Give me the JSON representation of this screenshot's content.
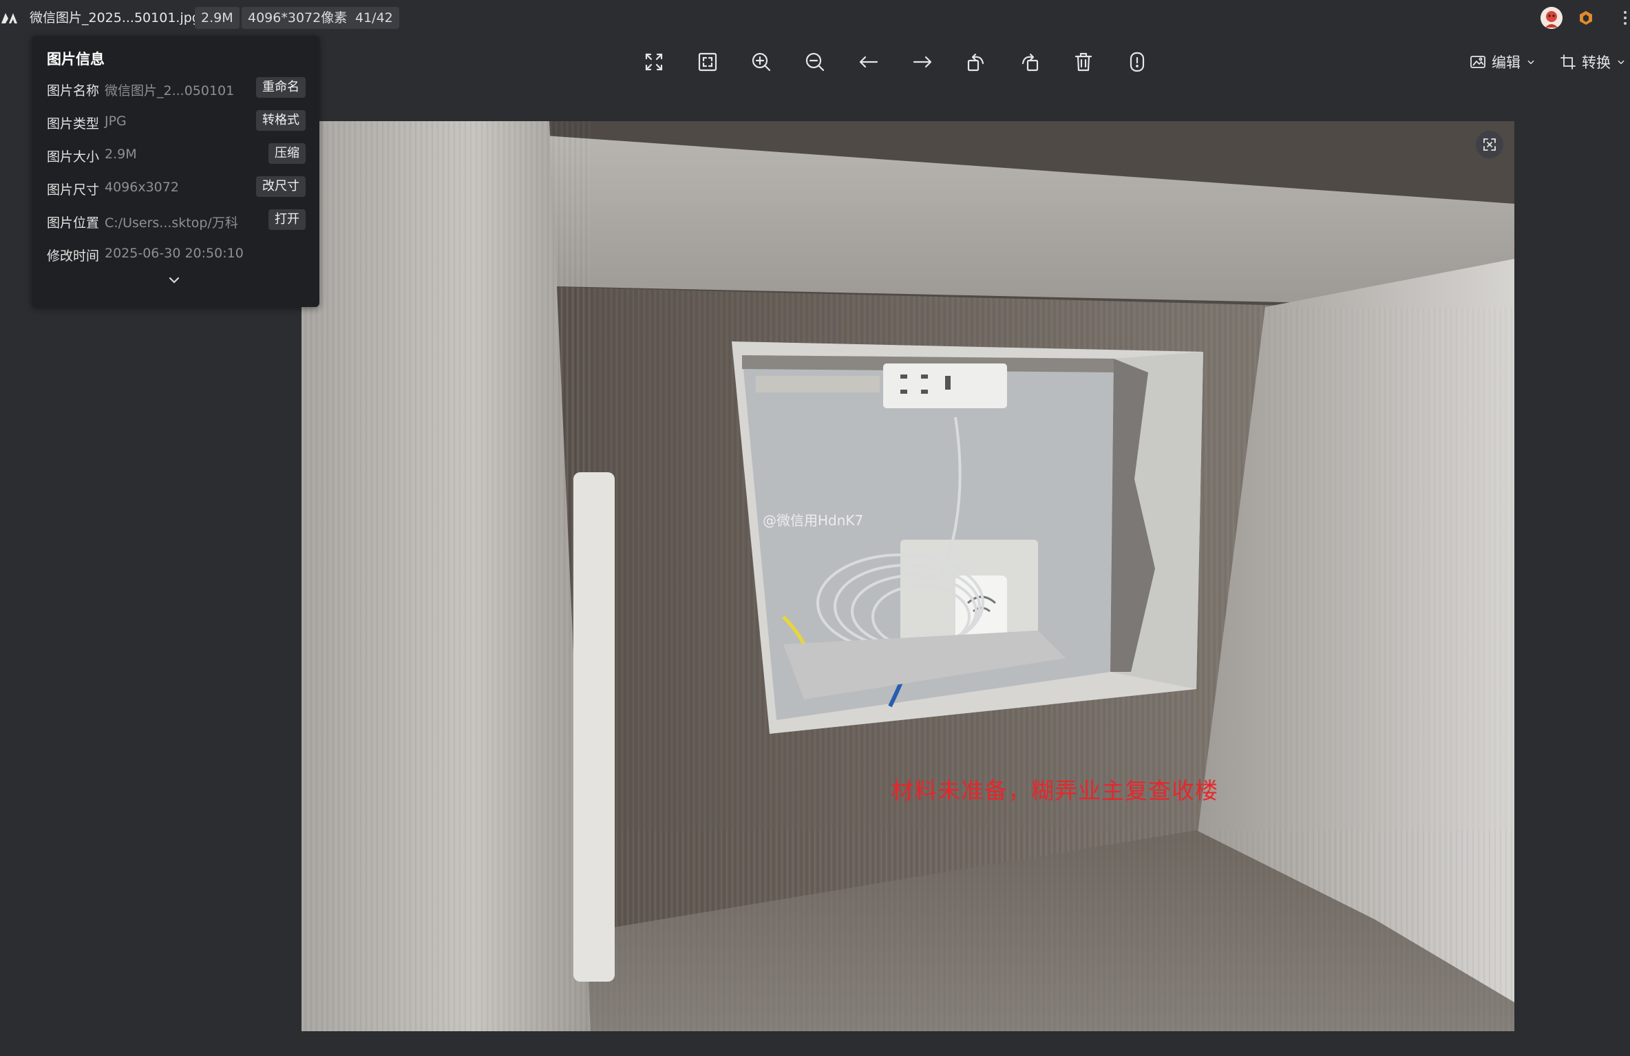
{
  "titlebar": {
    "file_name": "微信图片_2025...50101.jpg",
    "file_size": "2.9M",
    "dimensions": "4096*3072像素",
    "index": "41/42",
    "logo_icon": "app-logo-icon",
    "avatar_icon": "user-avatar-icon",
    "badge_icon": "vip-badge-icon",
    "more_icon": "more-icon"
  },
  "toolbar": {
    "buttons": [
      {
        "name": "fullscreen",
        "icon": "expand-arrows-icon"
      },
      {
        "name": "fit-window",
        "icon": "fit-frame-icon"
      },
      {
        "name": "zoom-in",
        "icon": "zoom-in-icon"
      },
      {
        "name": "zoom-out",
        "icon": "zoom-out-icon"
      },
      {
        "name": "previous",
        "icon": "arrow-left-icon"
      },
      {
        "name": "next",
        "icon": "arrow-right-icon"
      },
      {
        "name": "rotate-left",
        "icon": "rotate-left-icon"
      },
      {
        "name": "rotate-right",
        "icon": "rotate-right-icon"
      },
      {
        "name": "delete",
        "icon": "trash-icon"
      },
      {
        "name": "info",
        "icon": "info-icon"
      }
    ],
    "edit_label": "编辑",
    "convert_label": "转换"
  },
  "info_panel": {
    "title": "图片信息",
    "rows": [
      {
        "label": "图片名称",
        "value": "微信图片_2...050101",
        "button": "重命名"
      },
      {
        "label": "图片类型",
        "value": "JPG",
        "button": "转格式"
      },
      {
        "label": "图片大小",
        "value": "2.9M",
        "button": "压缩"
      },
      {
        "label": "图片尺寸",
        "value": "4096x3072",
        "button": "改尺寸"
      },
      {
        "label": "图片位置",
        "value": "C:/Users...sktop/万科",
        "button": "打开"
      },
      {
        "label": "修改时间",
        "value": "2025-06-30 20:50:10",
        "button": ""
      }
    ],
    "expand_icon": "chevron-down-icon"
  },
  "photo": {
    "watermark": "@微信用HdnK7",
    "annotation": "材料未准备，糊弄业主复查收楼"
  },
  "colors": {
    "background": "#2b2d31",
    "panel": "#1f2023",
    "annotation": "#e8262a"
  }
}
